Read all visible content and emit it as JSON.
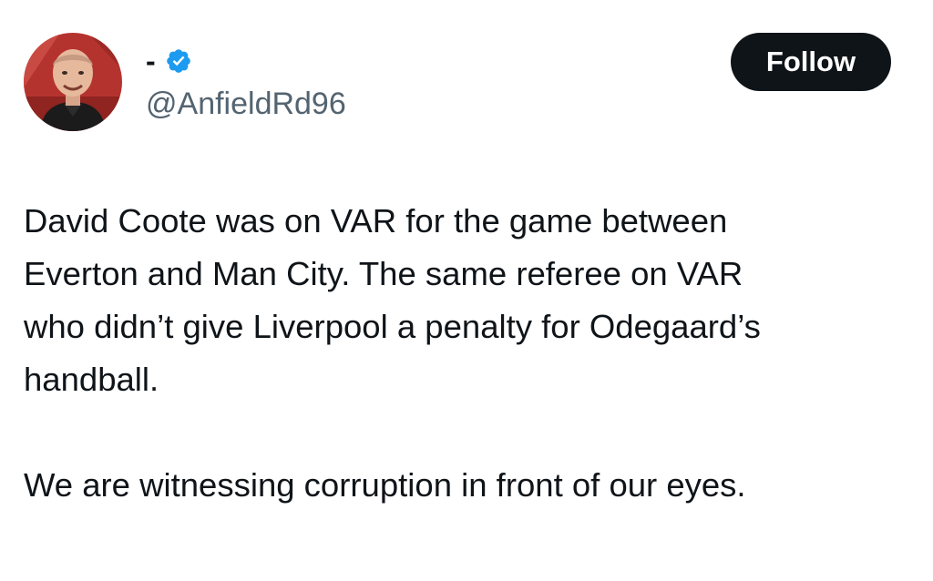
{
  "author": {
    "display_name": "-",
    "handle": "@AnfieldRd96",
    "verified": true,
    "avatar_icon": "user-avatar-photo",
    "verified_icon": "verified-badge-icon",
    "verified_color": "#1d9bf0"
  },
  "follow_button": {
    "label": "Follow",
    "background": "#0f1419",
    "text_color": "#ffffff"
  },
  "tweet": {
    "lines": [
      "David Coote was on VAR for the game between",
      "Everton and Man City. The same referee on VAR",
      "who didn’t give Liverpool a penalty for Odegaard’s",
      "handball.",
      "We are witnessing corruption in front of our eyes."
    ]
  },
  "colors": {
    "text_primary": "#0f1419",
    "text_secondary": "#536471",
    "background": "#ffffff"
  }
}
